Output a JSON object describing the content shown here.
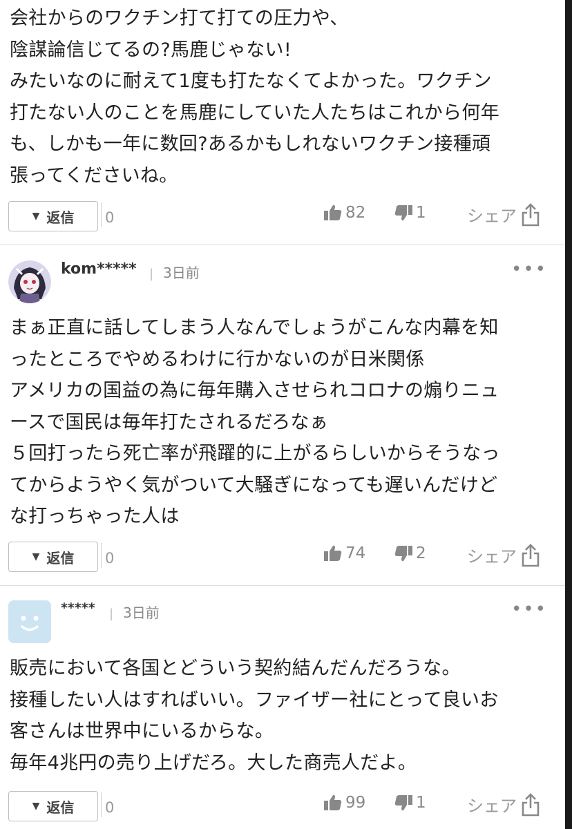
{
  "comments": [
    {
      "text": "会社からのワクチン打て打ての圧力や、\n陰謀論信じてるの?馬鹿じゃない!\nみたいなのに耐えて1度も打たなくてよかった。ワクチン\n打たない人のことを馬鹿にしていた人たちはこれから何年\nも、しかも一年に数回?あるかもしれないワクチン接種頑\n張ってくださいね。",
      "reply_label": "返信",
      "reply_count": "0",
      "likes": "82",
      "dislikes": "1",
      "share_label": "シェア"
    },
    {
      "user": "kom*****",
      "time": "3日前",
      "more": "•••",
      "text": "まぁ正直に話してしまう人なんでしょうがこんな内幕を知\nったところでやめるわけに行かないのが日米関係\nアメリカの国益の為に毎年購入させられコロナの煽りニュ\nースで国民は毎年打たされるだろなぁ\n５回打ったら死亡率が飛躍的に上がるらしいからそうなっ\nてからようやく気がついて大騒ぎになっても遅いんだけど\nな打っちゃった人は",
      "reply_label": "返信",
      "reply_count": "0",
      "likes": "74",
      "dislikes": "2",
      "share_label": "シェア"
    },
    {
      "user": "*****",
      "time": "3日前",
      "more": "•••",
      "text": "販売において各国とどういう契約結んだんだろうな。\n接種したい人はすればいい。ファイザー社にとって良いお\n客さんは世界中にいるからな。\n毎年4兆円の売り上げだろ。大した商売人だよ。",
      "reply_label": "返信",
      "reply_count": "0",
      "likes": "99",
      "dislikes": "1",
      "share_label": "シェア"
    }
  ],
  "meta_separator": "|",
  "icons": {
    "reply": "caret-down-icon",
    "like": "thumbs-up-icon",
    "dislike": "thumbs-down-icon",
    "share": "share-icon",
    "more": "more-icon"
  },
  "colors": {
    "text": "#222222",
    "muted": "#888888",
    "avatar_bg": "#cde5f3"
  }
}
